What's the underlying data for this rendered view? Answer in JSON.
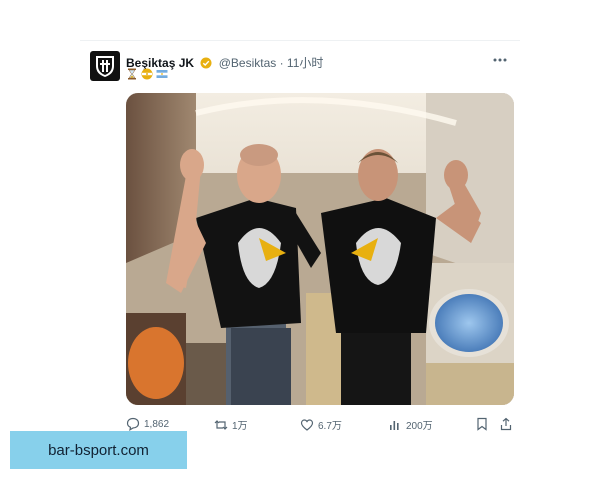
{
  "tweet": {
    "author_name": "Beşiktaş JK",
    "handle_time": "@Besiktas · 11小时",
    "emojis": [
      "hourglass-emoji",
      "argentina-football-emoji",
      "turkey-flag-emoji"
    ],
    "photo": "Two men in black eagle t-shirts posing with claw hands inside a private jet cabin"
  },
  "actions": {
    "replies": "1,862",
    "retweets": "1万",
    "likes": "6.7万",
    "views": "200万"
  },
  "watermark": "bar-bsport.com",
  "colors": {
    "accent_verified": "#e8b010",
    "watermark_bg": "#87d0eb",
    "muted_text": "#536471"
  }
}
